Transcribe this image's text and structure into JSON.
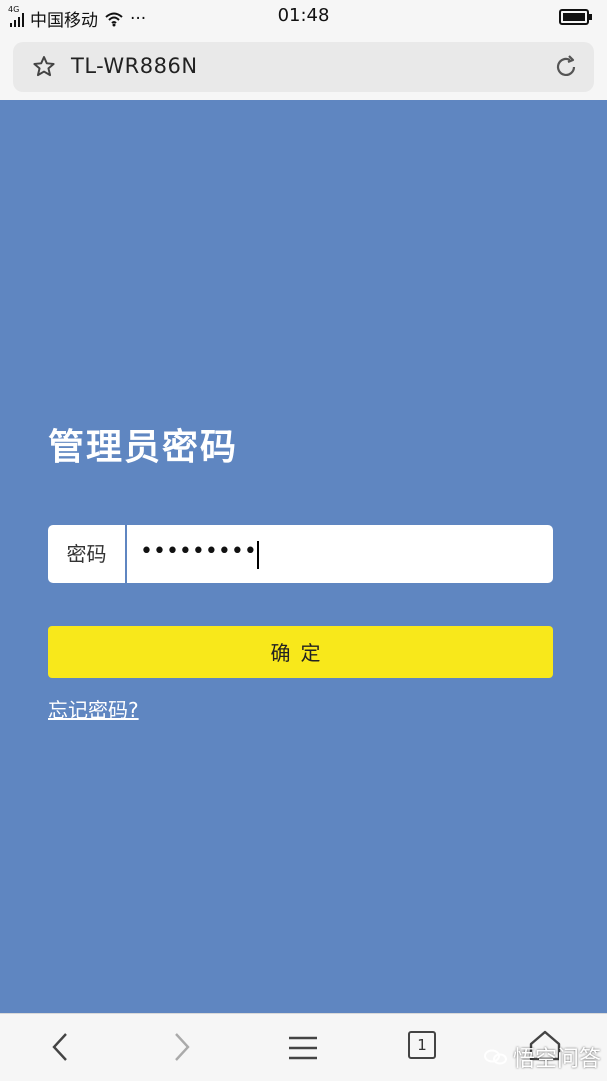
{
  "status_bar": {
    "network": "4G",
    "carrier": "中国移动",
    "dots": "···",
    "time": "01:48"
  },
  "browser": {
    "title": "TL-WR886N"
  },
  "login": {
    "title": "管理员密码",
    "password_label": "密码",
    "password_value": "•••••••••",
    "confirm_label": "确定",
    "forgot_label": "忘记密码?"
  },
  "bottom_nav": {
    "tab_count": "1"
  },
  "watermark": {
    "text": "悟空问答"
  },
  "icons": {
    "star": "star-icon",
    "reload": "reload-icon",
    "back": "chevron-left-icon",
    "forward": "chevron-right-icon",
    "menu": "menu-icon",
    "tabs": "tabs-icon",
    "home": "home-icon",
    "signal": "signal-icon",
    "wifi": "wifi-icon",
    "battery": "battery-icon"
  },
  "colors": {
    "background": "#5f86c1",
    "button": "#f8e81b",
    "text_white": "#ffffff"
  }
}
